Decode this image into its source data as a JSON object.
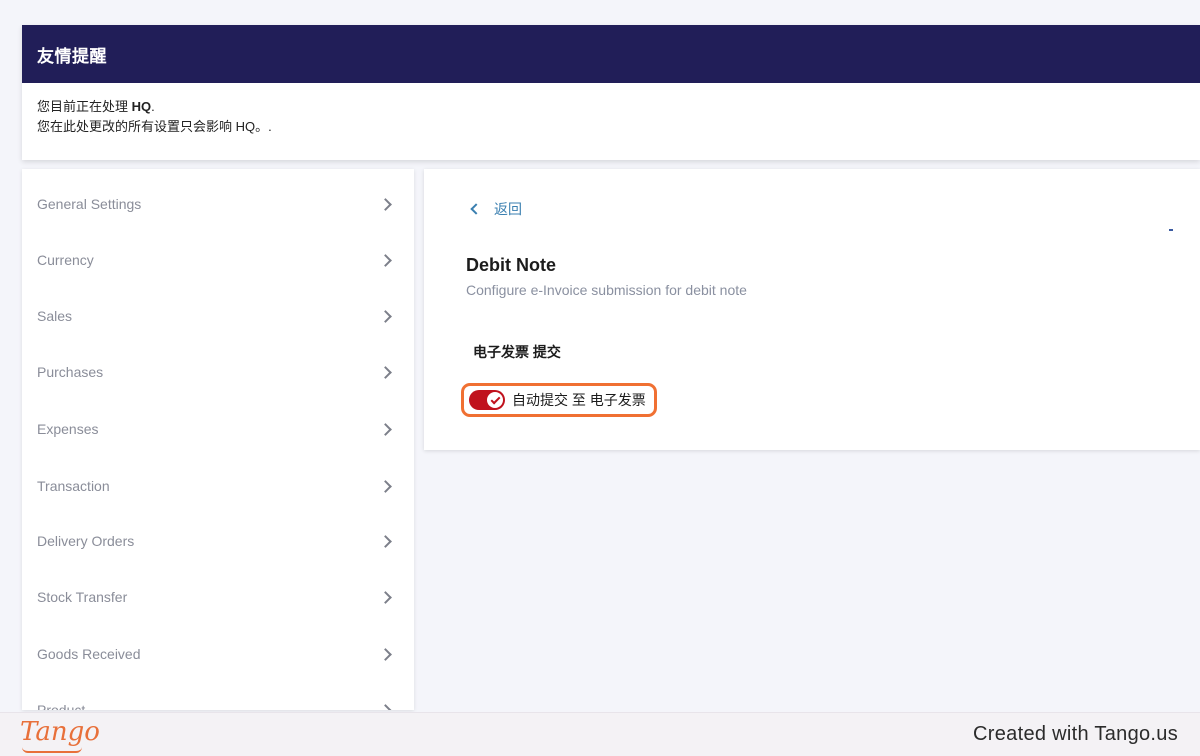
{
  "notice": {
    "title": "友情提醒",
    "line1_prefix": "您目前正在处理 ",
    "line1_entity": "HQ",
    "line1_suffix": ".",
    "line2": "您在此处更改的所有设置只会影响 HQ。."
  },
  "sidebar": {
    "items": [
      {
        "label": "General Settings"
      },
      {
        "label": "Currency"
      },
      {
        "label": "Sales"
      },
      {
        "label": "Purchases"
      },
      {
        "label": "Expenses"
      },
      {
        "label": "Transaction"
      },
      {
        "label": "Delivery Orders"
      },
      {
        "label": "Stock Transfer"
      },
      {
        "label": "Goods Received"
      },
      {
        "label": "Product"
      }
    ]
  },
  "panel": {
    "back_label": "返回",
    "title": "Debit Note",
    "subtitle": "Configure e-Invoice submission for debit note",
    "section_label": "电子发票 提交",
    "toggle_label": "自动提交 至 电子发票",
    "toggle_on": true
  },
  "footer": {
    "logo": "Tango",
    "created_with": "Created with Tango.us"
  },
  "colors": {
    "header_bg": "#211e58",
    "toggle_on": "#c0121d",
    "highlight": "#f07032",
    "link": "#3a7fb0"
  }
}
